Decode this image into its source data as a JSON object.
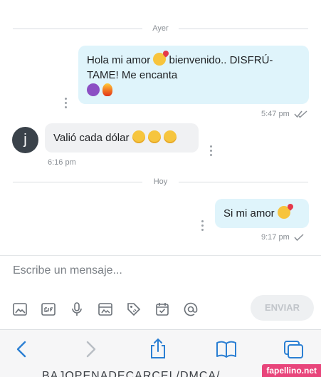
{
  "separators": {
    "yesterday": "Ayer",
    "today": "Hoy"
  },
  "messages": [
    {
      "direction": "out",
      "line1": "Hola mi amor",
      "line1b": "bienvenido.. DISFRÚ-",
      "line2": "TAME! Me encanta",
      "time": "5:47 pm"
    },
    {
      "direction": "in",
      "avatar_letter": "j",
      "text": "Valió cada dólar",
      "time": "6:16 pm"
    },
    {
      "direction": "out",
      "text": "Si mi amor",
      "time": "9:17 pm"
    }
  ],
  "composer": {
    "placeholder": "Escribe un mensaje...",
    "send_label": "ENVIAR",
    "icons": [
      "image-icon",
      "gif-icon",
      "microphone-icon",
      "media-icon",
      "tag-icon",
      "calendar-check-icon",
      "at-icon"
    ]
  },
  "browser": {
    "url": "BAJOPENADECARCEL/DMCA/",
    "icons": [
      "back-icon",
      "forward-icon",
      "share-icon",
      "bookmarks-icon",
      "tabs-icon"
    ]
  },
  "watermark": "fapellino.net",
  "colors": {
    "outgoing_bubble": "#dff4fb",
    "incoming_bubble": "#f0f1f3",
    "accent_blue": "#2b7fd3"
  }
}
